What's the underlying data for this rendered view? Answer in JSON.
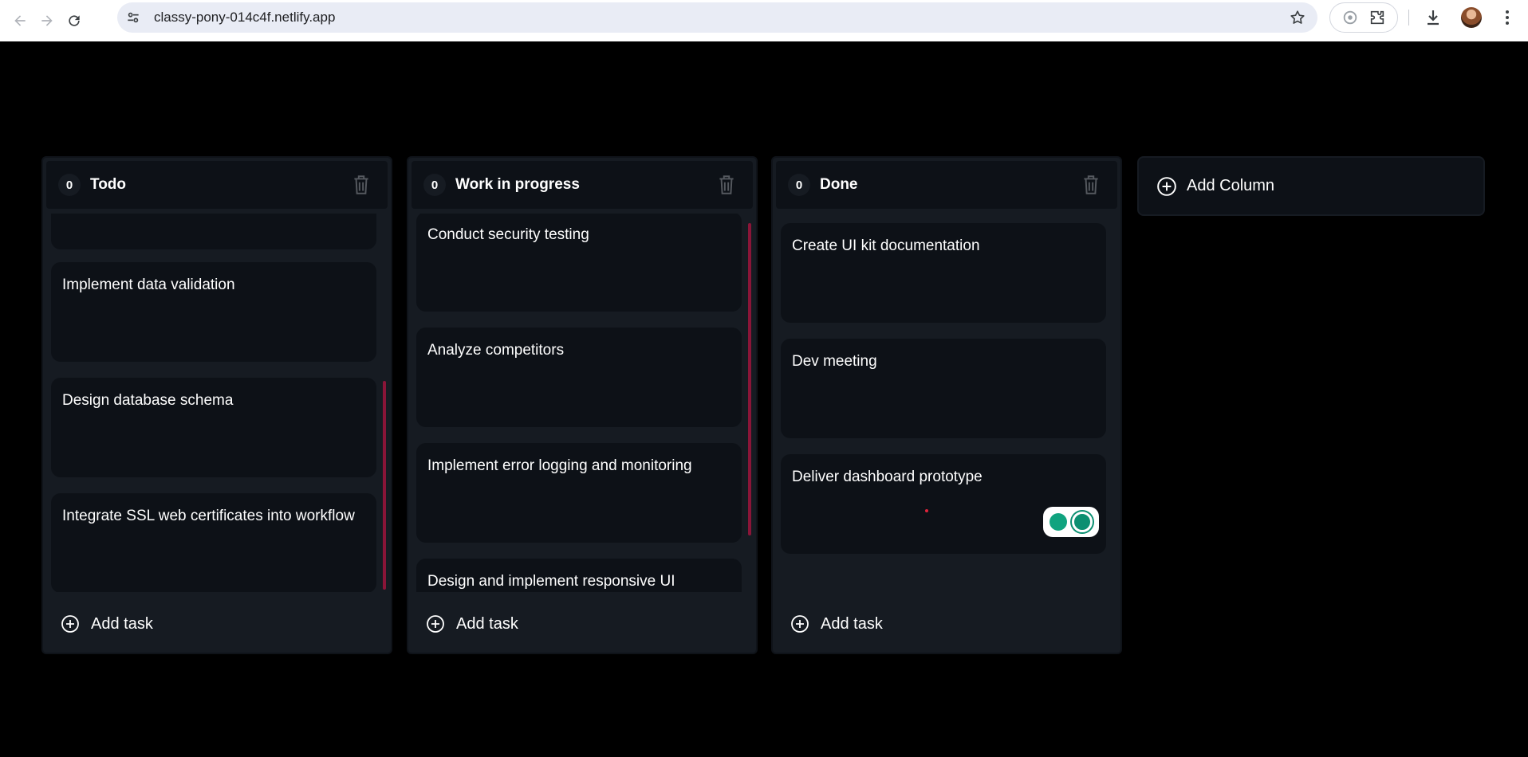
{
  "browser": {
    "url": "classy-pony-014c4f.netlify.app"
  },
  "board": {
    "columns": [
      {
        "count": "0",
        "title": "Todo",
        "tasks": [
          "",
          "Implement data validation",
          "Design database schema",
          "Integrate SSL web certificates into workflow"
        ],
        "add_task_label": "Add task"
      },
      {
        "count": "0",
        "title": "Work in progress",
        "tasks": [
          "Conduct security testing",
          "Analyze competitors",
          "Implement error logging and monitoring",
          "Design and implement responsive UI"
        ],
        "add_task_label": "Add task"
      },
      {
        "count": "0",
        "title": "Done",
        "tasks": [
          "Create UI kit documentation",
          "Dev meeting",
          "Deliver dashboard prototype"
        ],
        "add_task_label": "Add task"
      }
    ],
    "add_column_label": "Add Column"
  },
  "colors": {
    "background": "#000000",
    "column": "#161b22",
    "card": "#0d1117",
    "scrollbar": "#8a1538",
    "text": "#ffffff"
  }
}
